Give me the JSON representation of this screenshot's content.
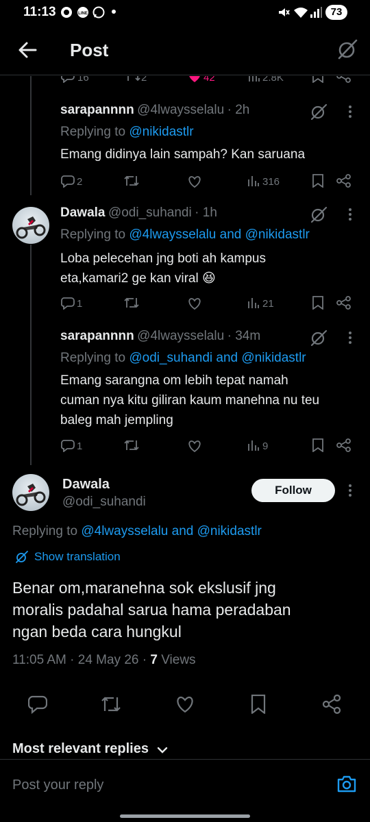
{
  "status_bar": {
    "time": "11:13",
    "battery": "73",
    "icons": [
      "alarm-icon",
      "line-icon",
      "whatsapp-icon",
      "dot-icon",
      "mute-icon",
      "wifi-icon",
      "signal-icon"
    ]
  },
  "header": {
    "title": "Post",
    "back_icon": "arrow-left-icon",
    "grok_icon": "grok-icon"
  },
  "top_counts": {
    "replies": "16",
    "reposts": "2",
    "likes": "42",
    "views": "2.8K"
  },
  "replies": [
    {
      "name": "sarapannnn",
      "handle": "@4lwaysselalu",
      "time": "· 2h",
      "replying_label": "Replying to",
      "replying_to": "@nikidastlr",
      "text": [
        "Emang didinya lain sampah? Kan saruana"
      ],
      "replies": "2",
      "views": "316"
    },
    {
      "name": "Dawala",
      "handle": "@odi_suhandi",
      "time": "· 1h",
      "replying_label": "Replying to",
      "replying_to": "@4lwaysselalu and @nikidastlr",
      "text": [
        "Loba pelecehan jng boti ah kampus",
        "eta,kamari2 ge kan viral 😆"
      ],
      "replies": "1",
      "views": "21"
    },
    {
      "name": "sarapannnn",
      "handle": "@4lwaysselalu",
      "time": "· 34m",
      "replying_label": "Replying to",
      "replying_to": "@odi_suhandi and @nikidastlr",
      "text": [
        "Emang sarangna om lebih tepat namah",
        "cuman nya kitu giliran kaum manehna nu teu",
        "baleg mah jempling"
      ],
      "replies": "1",
      "views": "9"
    }
  ],
  "main_post": {
    "name": "Dawala",
    "handle": "@odi_suhandi",
    "follow_label": "Follow",
    "replying_label": "Replying to",
    "replying_to": "@4lwaysselalu and @nikidastlr",
    "translation_label": "Show translation",
    "text": [
      "Benar om,maranehna sok ekslusif jng",
      "moralis padahal sarua hama peradaban",
      "ngan beda cara hungkul"
    ],
    "timestamp": "11:05 AM · 24 May 26 · ",
    "views_count": "7",
    "views_label": " Views"
  },
  "sort": {
    "label": "Most relevant replies"
  },
  "reply_bar": {
    "placeholder": "Post your reply"
  },
  "colors": {
    "background": "#000000",
    "text": "#e7e9ea",
    "muted": "#71767b",
    "link": "#1d9bf0",
    "like": "#f91880",
    "divider": "#2f3336"
  }
}
